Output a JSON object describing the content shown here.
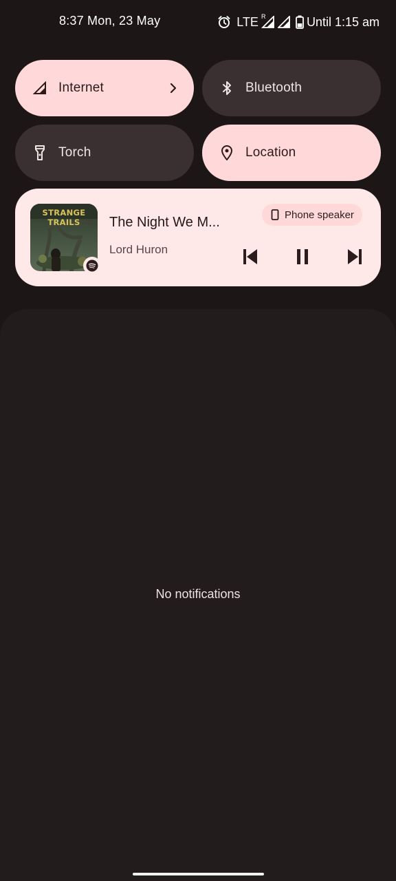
{
  "status_bar": {
    "time_date": "8:37 Mon, 23 May",
    "network": "LTE",
    "roaming": "R",
    "battery_text": "Until 1:15 am",
    "icons": [
      "alarm-icon",
      "signal-roaming-icon",
      "signal-icon",
      "battery-icon"
    ]
  },
  "quick_settings": {
    "tiles": [
      {
        "label": "Internet",
        "icon": "cell-signal-icon",
        "active": true,
        "has_chevron": true
      },
      {
        "label": "Bluetooth",
        "icon": "bluetooth-icon",
        "active": false
      },
      {
        "label": "Torch",
        "icon": "flashlight-icon",
        "active": false
      },
      {
        "label": "Location",
        "icon": "location-pin-icon",
        "active": true
      }
    ]
  },
  "media": {
    "album_art_title": "STRANGE TRAILS",
    "song_title": "The Night We M...",
    "artist": "Lord Huron",
    "output_label": "Phone speaker",
    "app_icon": "spotify-icon",
    "controls": [
      "previous-icon",
      "pause-icon",
      "next-icon"
    ]
  },
  "notifications": {
    "empty_text": "No notifications"
  },
  "colors": {
    "background": "#1c1617",
    "tile_active": "#ffd9da",
    "tile_inactive": "#3a3031",
    "media_card": "#ffe9e8",
    "shade": "#221c1c"
  }
}
